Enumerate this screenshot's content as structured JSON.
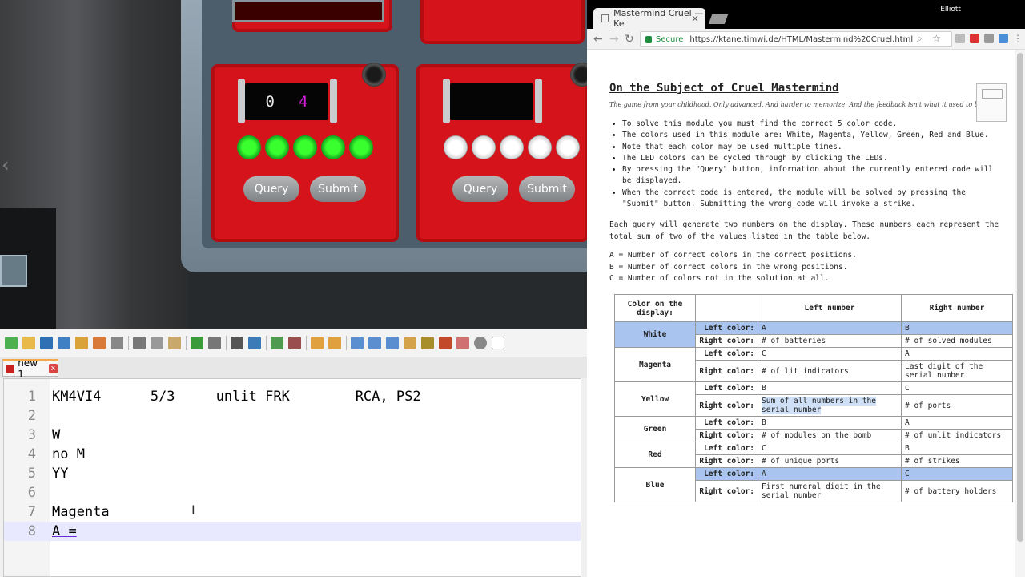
{
  "game": {
    "module_left": {
      "display_a": "0",
      "display_b": "4",
      "led_colors": [
        "green",
        "green",
        "green",
        "green",
        "green"
      ],
      "query_label": "Query",
      "submit_label": "Submit"
    },
    "module_right": {
      "led_colors": [
        "white",
        "white",
        "white",
        "white",
        "white"
      ],
      "query_label": "Query",
      "submit_label": "Submit"
    }
  },
  "notepad": {
    "tab_label": "new 1",
    "tab_close": "x",
    "lines": [
      {
        "n": "1",
        "text": "KM4VI4      5/3     unlit FRK        RCA, PS2"
      },
      {
        "n": "2",
        "text": ""
      },
      {
        "n": "3",
        "text": "W"
      },
      {
        "n": "4",
        "text": "no M"
      },
      {
        "n": "5",
        "text": "YY"
      },
      {
        "n": "6",
        "text": ""
      },
      {
        "n": "7",
        "text": "Magenta"
      },
      {
        "n": "8",
        "text": "A ="
      }
    ]
  },
  "browser": {
    "tab_title": "Mastermind Cruel — Ke",
    "tab_close": "×",
    "user": "Elliott",
    "secure_label": "Secure",
    "url": "https://ktane.timwi.de/HTML/Mastermind%20Cruel.html",
    "page": {
      "title": "On the Subject of Cruel Mastermind",
      "subtitle": "The game from your childhood. Only advanced. And harder to memorize. And the feedback isn't what it used to be...",
      "rules": [
        "To solve this module you must find the correct 5 color code.",
        "The colors used in this module are: White, Magenta, Yellow, Green, Red and Blue.",
        "Note that each color may be used multiple times.",
        "The LED colors can be cycled through by clicking the LEDs.",
        "By pressing the \"Query\" button, information about the currently entered code will be displayed.",
        "When the correct code is entered, the module will be solved by pressing the \"Submit\" button. Submitting the wrong code will invoke a strike."
      ],
      "para1_a": "Each query will generate two numbers on the display. These numbers each represent the ",
      "para1_u": "total",
      "para1_b": " sum of two of the values listed in the table below.",
      "defs": [
        "A = Number of correct colors in the correct positions.",
        "B = Number of correct colors in the wrong positions.",
        "C = Number of colors not in the solution at all."
      ],
      "table": {
        "headers": [
          "Color on the display:",
          "",
          "Left number",
          "Right number"
        ],
        "left_label": "Left color:",
        "right_label": "Right color:",
        "rows": [
          {
            "color": "White",
            "left": [
              "A",
              "B"
            ],
            "right": [
              "# of batteries",
              "# of solved modules"
            ]
          },
          {
            "color": "Magenta",
            "left": [
              "C",
              "A"
            ],
            "right": [
              "# of lit indicators",
              "Last digit of the serial number"
            ]
          },
          {
            "color": "Yellow",
            "left": [
              "B",
              "C"
            ],
            "right": [
              "Sum of all numbers in the serial number",
              "# of ports"
            ]
          },
          {
            "color": "Green",
            "left": [
              "B",
              "A"
            ],
            "right": [
              "# of modules on the bomb",
              "# of unlit indicators"
            ]
          },
          {
            "color": "Red",
            "left": [
              "C",
              "B"
            ],
            "right": [
              "# of unique ports",
              "# of strikes"
            ]
          },
          {
            "color": "Blue",
            "left": [
              "A",
              "C"
            ],
            "right": [
              "First numeral digit in the serial number",
              "# of battery holders"
            ]
          }
        ]
      }
    }
  }
}
